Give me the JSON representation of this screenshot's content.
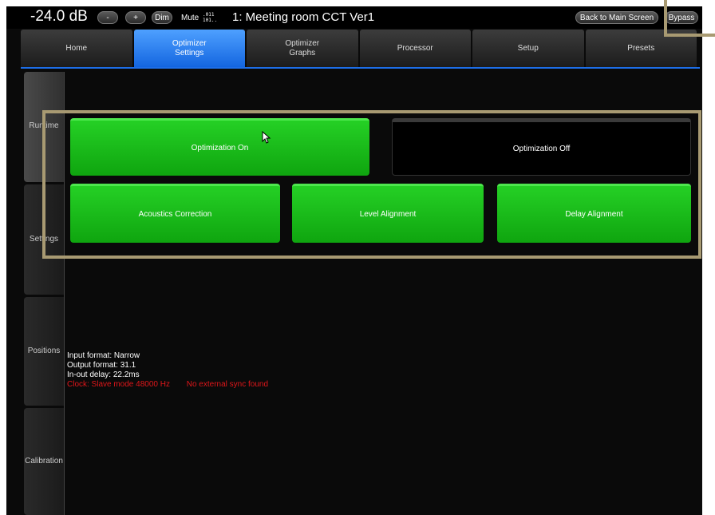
{
  "topbar": {
    "level": "-24.0 dB",
    "minus_label": "-",
    "plus_label": "+",
    "dim_label": "Dim",
    "mute_label": "Mute",
    "bits_top": ".011",
    "bits_bottom": "101..",
    "title": "1: Meeting room CCT Ver1",
    "back_label": "Back to Main Screen",
    "bypass_label": "Bypass"
  },
  "tabs": [
    {
      "label": "Home"
    },
    {
      "label": "Optimizer Settings",
      "active": true
    },
    {
      "label": "Optimizer Graphs"
    },
    {
      "label": "Processor"
    },
    {
      "label": "Setup"
    },
    {
      "label": "Presets"
    }
  ],
  "sidebar": {
    "items": [
      {
        "label": "Runtime"
      },
      {
        "label": "Settings"
      },
      {
        "label": "Positions"
      },
      {
        "label": "Calibration"
      }
    ]
  },
  "buttons": {
    "optimization_on": "Optimization On",
    "optimization_off": "Optimization Off",
    "acoustics_correction": "Acoustics Correction",
    "level_alignment": "Level Alignment",
    "delay_alignment": "Delay Alignment"
  },
  "status": {
    "input_format": "Input format: Narrow",
    "output_format": "Output format: 31.1",
    "delay": "In-out delay: 22.2ms",
    "clock": "Clock: Slave mode 48000 Hz",
    "sync": "No external sync found"
  },
  "colors": {
    "accent_blue": "#1466e0",
    "button_green": "#0fa50f",
    "highlight": "#a89a72",
    "error_red": "#e0161a"
  }
}
